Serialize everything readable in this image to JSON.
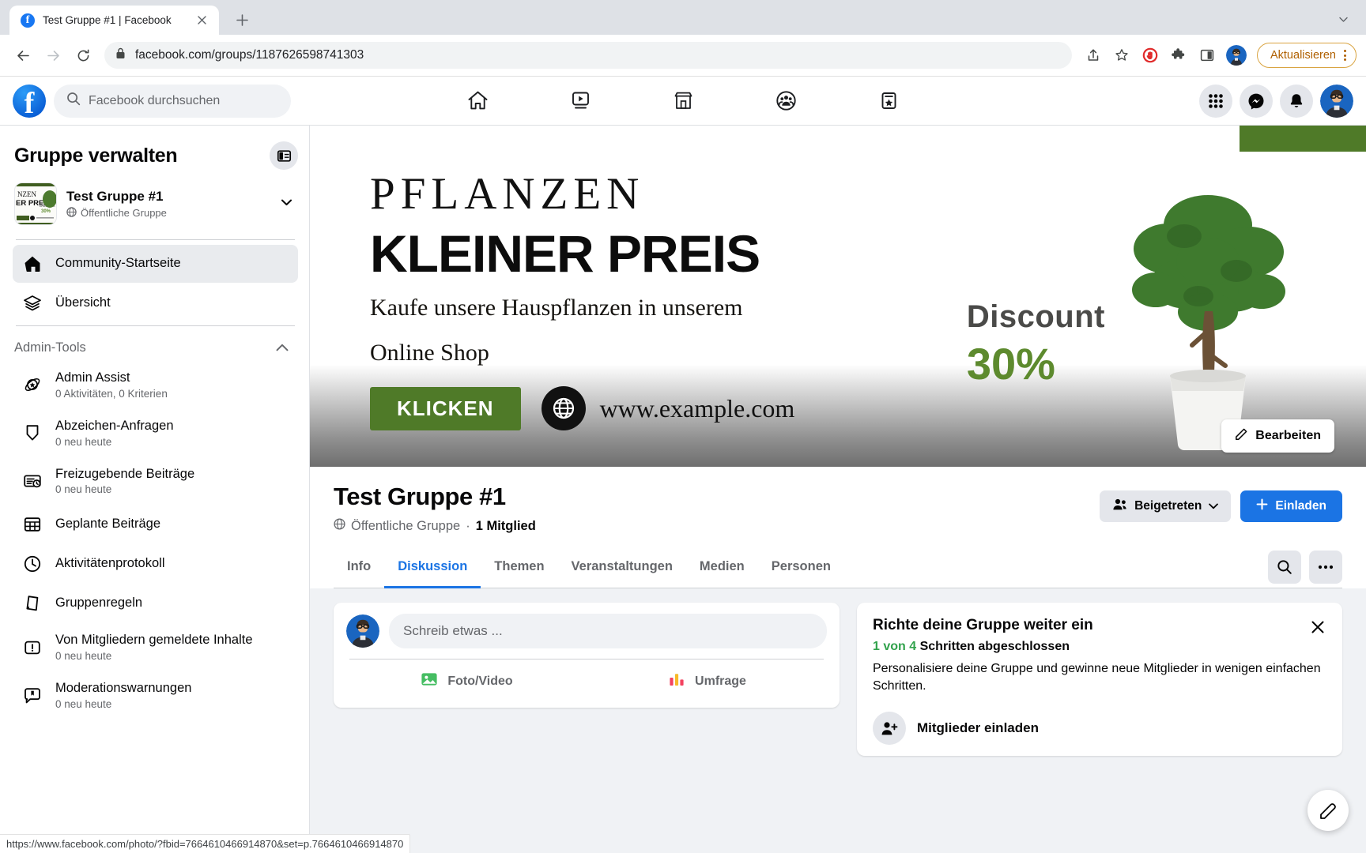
{
  "browser": {
    "tab": {
      "title": "Test Gruppe #1 | Facebook",
      "favicon": "facebook-icon",
      "close": "×"
    },
    "new_tab_label": "+",
    "tabstrip_chevron": "⌄",
    "omnibox": {
      "lock": "lock-icon",
      "url_prefix": "facebook.com",
      "url_path": "/groups/1187626598741303",
      "full_url": "facebook.com/groups/1187626598741303"
    },
    "nav": {
      "back": "←",
      "forward": "→",
      "reload": "⟳"
    },
    "actions": {
      "share": "share-icon",
      "bookmark": "star-icon",
      "adblock": "adblock-icon",
      "extensions": "puzzle-icon",
      "side_panel": "side-panel-icon",
      "profile": "profile-avatar"
    },
    "update_button": {
      "label": "Aktualisieren",
      "color": "#b06000",
      "border": "#d9a441"
    },
    "status_bar_url": "https://www.facebook.com/photo/?fbid=7664610466914870&set=p.7664610466914870"
  },
  "fb_header": {
    "logo": "facebook-logo",
    "search_placeholder": "Facebook durchsuchen",
    "nav_items": [
      {
        "name": "home-icon",
        "label": "Startseite"
      },
      {
        "name": "video-icon",
        "label": "Video"
      },
      {
        "name": "marketplace-icon",
        "label": "Marketplace"
      },
      {
        "name": "groups-icon",
        "label": "Gruppen"
      },
      {
        "name": "gaming-icon",
        "label": "Gaming"
      }
    ],
    "right_items": [
      {
        "name": "grid-menu-icon",
        "label": "Menü"
      },
      {
        "name": "messenger-icon",
        "label": "Messenger"
      },
      {
        "name": "bell-icon",
        "label": "Benachrichtigungen"
      },
      {
        "name": "account-avatar",
        "label": "Konto"
      }
    ]
  },
  "sidebar": {
    "title": "Gruppe verwalten",
    "panel_toggle": "panel-toggle-icon",
    "group": {
      "name": "Test Gruppe #1",
      "privacy": "Öffentliche Gruppe",
      "privacy_icon": "globe-icon",
      "caret": "▼"
    },
    "primary_items": [
      {
        "icon": "home-icon",
        "label": "Community-Startseite",
        "active": true
      },
      {
        "icon": "layers-icon",
        "label": "Übersicht",
        "active": false
      }
    ],
    "section": {
      "label": "Admin-Tools",
      "chevron": "chevron-up-icon"
    },
    "admin_items": [
      {
        "icon": "admin-assist-icon",
        "label": "Admin Assist",
        "sub": "0 Aktivitäten, 0 Kriterien"
      },
      {
        "icon": "badge-icon",
        "label": "Abzeichen-Anfragen",
        "sub": "0 neu heute"
      },
      {
        "icon": "pending-posts-icon",
        "label": "Freizugebende Beiträge",
        "sub": "0 neu heute"
      },
      {
        "icon": "calendar-icon",
        "label": "Geplante Beiträge",
        "sub": ""
      },
      {
        "icon": "clock-icon",
        "label": "Aktivitätenprotokoll",
        "sub": ""
      },
      {
        "icon": "rules-book-icon",
        "label": "Gruppenregeln",
        "sub": ""
      },
      {
        "icon": "report-icon",
        "label": "Von Mitgliedern gemeldete Inhalte",
        "sub": "0 neu heute"
      },
      {
        "icon": "moderation-alert-icon",
        "label": "Moderationswarnungen",
        "sub": "0 neu heute"
      }
    ]
  },
  "cover_ad": {
    "line1": "PFLANZEN",
    "line2": "KLEINER PREIS",
    "line3_a": "Kaufe unsere Hauspflanzen in unserem",
    "line3_b": "Online Shop",
    "cta_label": "KLICKEN",
    "website": "www.example.com",
    "globe_icon": "globe-icon",
    "discount_label": "Discount",
    "discount_value": "30%",
    "accent_green": "#5d8a2e",
    "edit_button": {
      "label": "Bearbeiten",
      "icon": "pencil-icon"
    }
  },
  "group_header": {
    "title": "Test Gruppe #1",
    "privacy_icon": "globe-icon",
    "privacy": "Öffentliche Gruppe",
    "separator": "·",
    "members": "1 Mitglied",
    "joined_button": {
      "label": "Beigetreten",
      "icon": "members-icon",
      "caret": "▼"
    },
    "invite_button": {
      "label": "Einladen",
      "icon": "plus-icon"
    },
    "search_icon": "search-icon",
    "more_icon": "more-horizontal-icon"
  },
  "tabs": [
    {
      "label": "Info",
      "active": false
    },
    {
      "label": "Diskussion",
      "active": true
    },
    {
      "label": "Themen",
      "active": false
    },
    {
      "label": "Veranstaltungen",
      "active": false
    },
    {
      "label": "Medien",
      "active": false
    },
    {
      "label": "Personen",
      "active": false
    }
  ],
  "composer": {
    "avatar": "user-avatar",
    "placeholder": "Schreib etwas ...",
    "actions": [
      {
        "icon": "photo-video-icon",
        "label": "Foto/Video"
      },
      {
        "icon": "poll-icon",
        "label": "Umfrage"
      }
    ]
  },
  "setup_card": {
    "title": "Richte deine Gruppe weiter ein",
    "steps_done": "1 von 4",
    "steps_suffix": "Schritten abgeschlossen",
    "description": "Personalisiere deine Gruppe und gewinne neue Mitglieder in wenigen einfachen Schritten.",
    "close_icon": "close-icon",
    "items": [
      {
        "icon": "invite-members-icon",
        "label": "Mitglieder einladen"
      }
    ]
  },
  "fab": {
    "icon": "compose-icon"
  }
}
